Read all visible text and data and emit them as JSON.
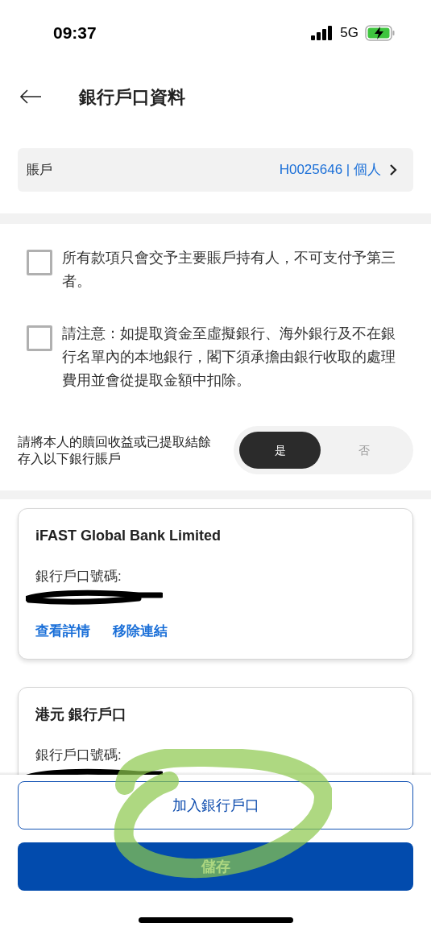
{
  "status_bar": {
    "time": "09:37",
    "network": "5G"
  },
  "header": {
    "title": "銀行戶口資料"
  },
  "account": {
    "label": "賬戶",
    "value": "H0025646 | 個人"
  },
  "declarations": [
    {
      "text": "所有款項只會交予主要賬戶持有人，不可支付予第三者。",
      "checked": false
    },
    {
      "text": "請注意：如提取資金至虛擬銀行、海外銀行及不在銀行名單內的本地銀行，閣下須承擔由銀行收取的處理費用並會從提取金額中扣除。",
      "checked": false
    }
  ],
  "toggle": {
    "label": "請將本人的贖回收益或已提取結餘存入以下銀行賬戶",
    "options": [
      {
        "label": "是",
        "selected": true
      },
      {
        "label": "否",
        "selected": false
      }
    ]
  },
  "bank_accounts": [
    {
      "name": "iFAST Global Bank Limited",
      "number_label": "銀行戶口號碼:",
      "redacted": true,
      "actions": [
        "查看詳情",
        "移除連結"
      ]
    },
    {
      "name": "港元 銀行戶口",
      "number_label": "銀行戶口號碼:",
      "redacted": true
    }
  ],
  "buttons": {
    "add": "加入銀行戶口",
    "save": "儲存"
  }
}
